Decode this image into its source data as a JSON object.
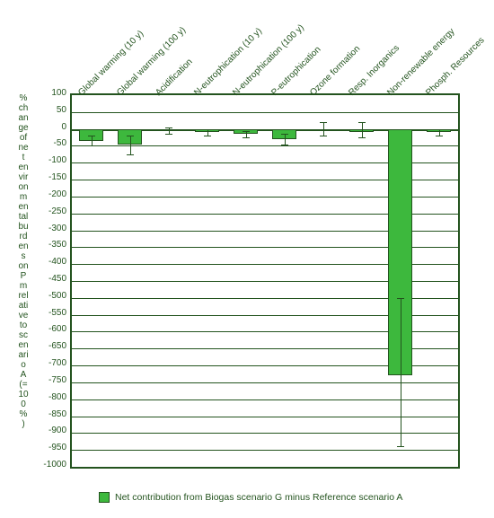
{
  "chart_data": {
    "type": "bar",
    "categories": [
      "Global warming (10 y)",
      "Global warming (100 y)",
      "Acidification",
      "N-eutrophication (10 y)",
      "N-eutrophication (100 y)",
      "P-eutrophication",
      "Ozone formation",
      "Resp. Inorganics",
      "Non-renewable energy",
      "Phosph. Resources"
    ],
    "series": [
      {
        "name": "Net contribution from Biogas scenario G minus Reference scenario A",
        "values": [
          -35,
          -45,
          -5,
          -10,
          -15,
          -30,
          -5,
          -10,
          -730,
          -10
        ],
        "color": "#3db83d"
      }
    ],
    "error_bars": [
      {
        "low": -50,
        "high": -20
      },
      {
        "low": -75,
        "high": -20
      },
      {
        "low": -15,
        "high": 5
      },
      {
        "low": -20,
        "high": -2
      },
      {
        "low": -25,
        "high": -5
      },
      {
        "low": -45,
        "high": -15
      },
      {
        "low": -20,
        "high": 20
      },
      {
        "low": -25,
        "high": 20
      },
      {
        "low": -940,
        "high": -500
      },
      {
        "low": -20,
        "high": -2
      }
    ],
    "ylabel": "% change of net environmental burdens on Pm relative to scenario A (=100%)",
    "ylim": [
      -1000,
      100
    ],
    "yticks": [
      100,
      50,
      0,
      -50,
      -100,
      -150,
      -200,
      -250,
      -300,
      -350,
      -400,
      -450,
      -500,
      -550,
      -600,
      -650,
      -700,
      -750,
      -800,
      -850,
      -900,
      -950,
      -1000
    ],
    "xlabel": ""
  }
}
